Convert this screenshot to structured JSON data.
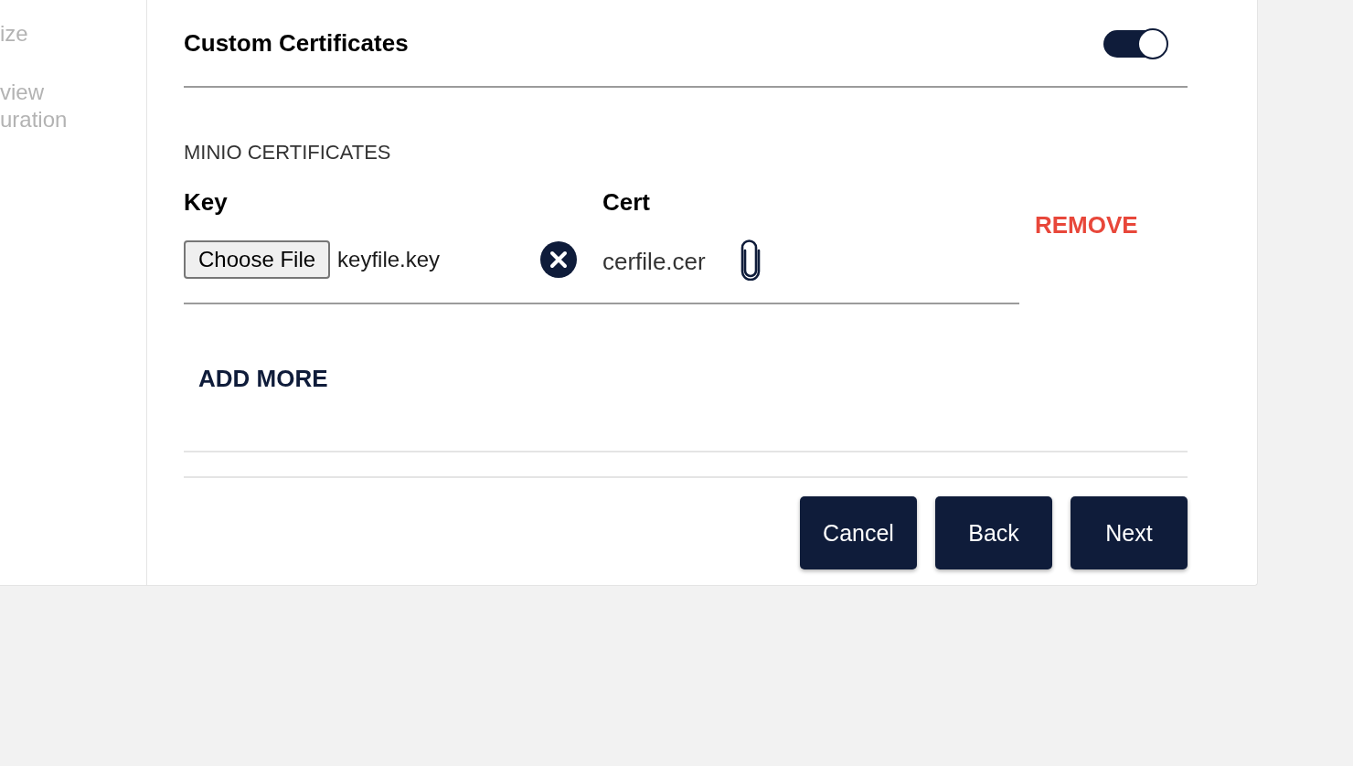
{
  "sidebar": {
    "items": [
      {
        "lines": [
          "ize"
        ]
      },
      {
        "lines": [
          "view",
          "uration"
        ]
      }
    ]
  },
  "section": {
    "title": "Custom Certificates",
    "toggle": {
      "on": true
    }
  },
  "certificates": {
    "heading": "MINIO CERTIFICATES",
    "pairs": [
      {
        "key_label": "Key",
        "key_file": {
          "button": "Choose File",
          "file_name": "keyfile.key"
        },
        "cert_label": "Cert",
        "cert_file": {
          "file_name": "cerfile.cer"
        },
        "remove": "REMOVE"
      }
    ],
    "add_more": "ADD MORE"
  },
  "buttons": [
    {
      "label": "Cancel"
    },
    {
      "label": "Back"
    },
    {
      "label": "Next"
    }
  ]
}
